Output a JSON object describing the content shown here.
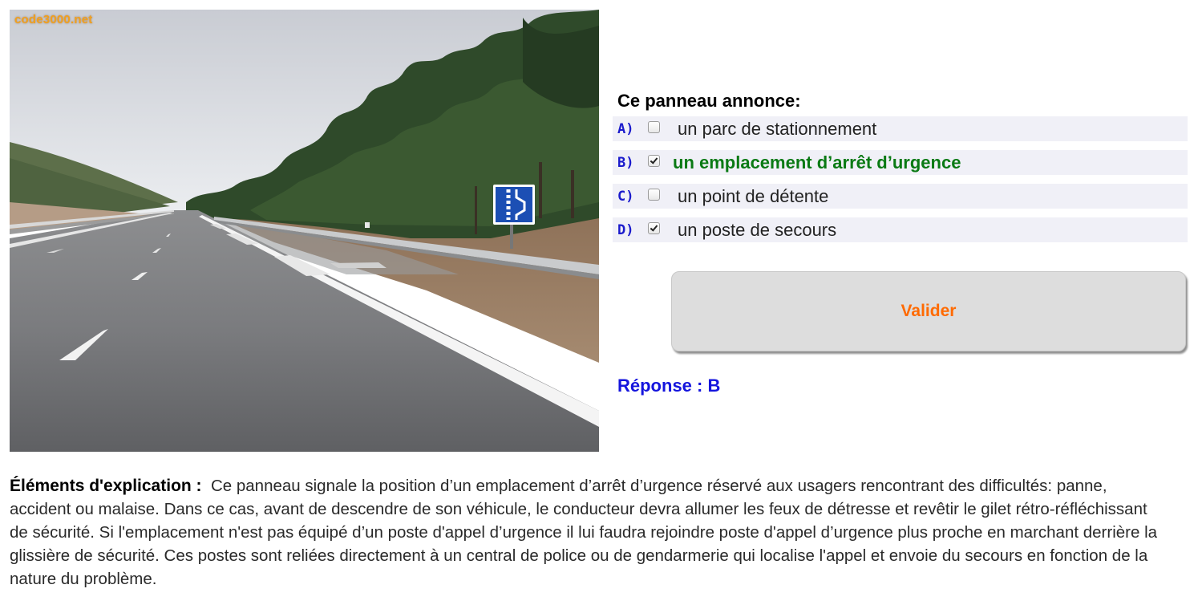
{
  "site": {
    "watermark": "code3000.net"
  },
  "question": {
    "prompt": "Ce panneau annonce:",
    "answers": [
      {
        "letter": "A)",
        "text": "un parc de stationnement",
        "checked": false,
        "correct": false
      },
      {
        "letter": "B)",
        "text": "un emplacement d’arrêt d’urgence",
        "checked": true,
        "correct": true
      },
      {
        "letter": "C)",
        "text": "un point de détente",
        "checked": false,
        "correct": false
      },
      {
        "letter": "D)",
        "text": "un poste de secours",
        "checked": true,
        "correct": false
      }
    ],
    "validate_label": "Valider",
    "result": "Réponse : B"
  },
  "explanation": {
    "label": "Éléments d'explication :",
    "text": "Ce panneau signale la position d’un emplacement d’arrêt d’urgence réservé aux usagers rencontrant des difficultés: panne, accident ou malaise. Dans ce cas, avant de descendre de son véhicule, le conducteur devra allumer les feux de détresse et revêtir le gilet rétro-réfléchissant de sécurité. Si l'emplacement n'est pas équipé d’un poste d'appel d’urgence il lui faudra rejoindre poste d'appel d’urgence plus proche en marchant derrière la glissière de sécurité. Ces postes sont reliées directement à un central de police ou de gendarmerie qui localise l'appel et envoie du secours en fonction de la nature du problème."
  },
  "colors": {
    "answer_letter": "#1a1acc",
    "correct_answer": "#0a7a14",
    "validate_text": "#ff6a00",
    "result_text": "#1515dd",
    "answer_row_bg": "#f0f0f7"
  },
  "icons": {
    "road_sign": "emergency-stop-bay-sign-icon",
    "checkbox": "checkbox-icon"
  }
}
